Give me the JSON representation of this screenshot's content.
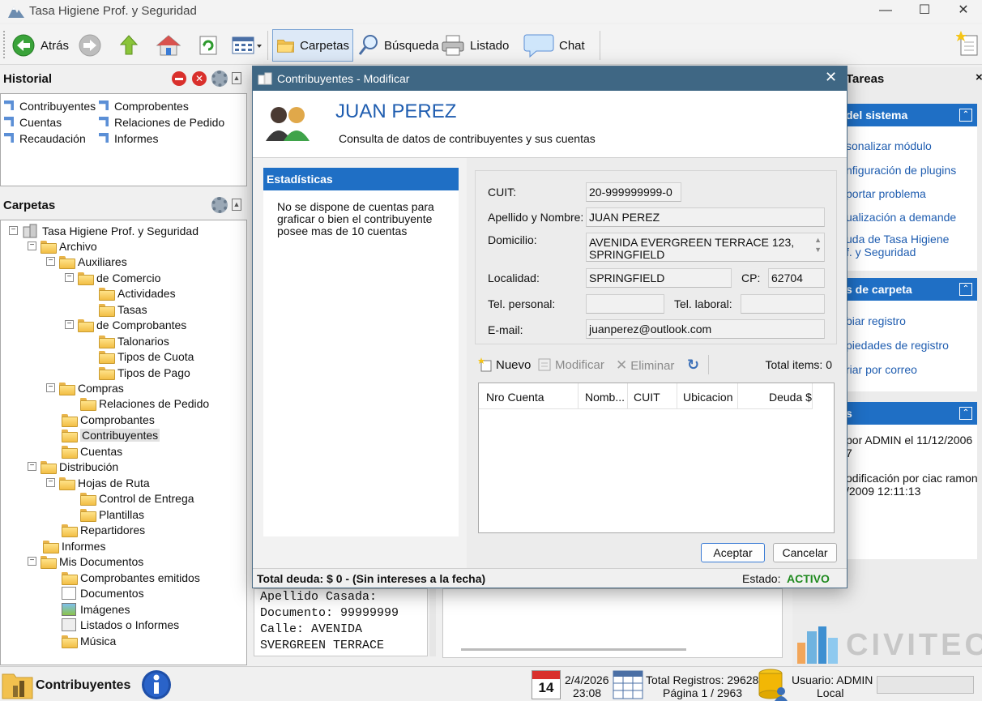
{
  "window": {
    "title": "Tasa Higiene Prof. y Seguridad"
  },
  "toolbar": {
    "back": "Atrás",
    "folders": "Carpetas",
    "search": "Búsqueda",
    "list": "Listado",
    "chat": "Chat"
  },
  "historial": {
    "title": "Historial",
    "col1": [
      "Contribuyentes",
      "Cuentas",
      "Recaudación"
    ],
    "col2": [
      "Comprobentes",
      "Relaciones de Pedido",
      "Informes"
    ]
  },
  "carpetas": {
    "title": "Carpetas",
    "tree": [
      "Tasa Higiene Prof. y Seguridad",
      "Archivo",
      "Auxiliares",
      "de Comercio",
      "Actividades",
      "Tasas",
      "de Comprobantes",
      "Talonarios",
      "Tipos de Cuota",
      "Tipos de Pago",
      "Compras",
      "Relaciones de Pedido",
      "Comprobantes",
      "Contribuyentes",
      "Cuentas",
      "Distribución",
      "Hojas de Ruta",
      "Control de Entrega",
      "Plantillas",
      "Repartidores",
      "Informes",
      "Mis Documentos",
      "Comprobantes emitidos",
      "Documentos",
      "Imágenes",
      "Listados o Informes",
      "Música"
    ]
  },
  "tasks": {
    "title": "Tareas",
    "system_header": "del sistema",
    "system_links": [
      "sonalizar módulo",
      "nfiguración de plugins",
      "portar problema",
      "ualización a demande",
      "uda de Tasa Higiene",
      "f. y Seguridad"
    ],
    "folder_header": "s de carpeta",
    "folder_links": [
      "biar registro",
      "piedades de registro",
      "riar por correo"
    ],
    "details_header": "s",
    "details_lines": [
      "por ADMIN el 11/12/2006",
      "7",
      "odificación por ciac ramon",
      "/2009 12:11:13"
    ]
  },
  "background_text": {
    "lines": [
      "Apellido Casada:",
      "Documento: 99999999",
      "Calle: AVENIDA",
      "SVERGREEN TERRACE"
    ]
  },
  "dialog": {
    "title": "Contribuyentes - Modificar",
    "name": "JUAN PEREZ",
    "subtitle": "Consulta de datos de contribuyentes y sus cuentas",
    "stats_title": "Estadísticas",
    "stats_text": "No se dispone de cuentas para graficar o bien el contribuyente posee mas de 10 cuentas",
    "labels": {
      "cuit": "CUIT:",
      "name": "Apellido y Nombre:",
      "address": "Domicilio:",
      "city": "Localidad:",
      "cp": "CP:",
      "tel_personal": "Tel. personal:",
      "tel_laboral": "Tel. laboral:",
      "email": "E-mail:"
    },
    "values": {
      "cuit": "20-999999999-0",
      "name": "JUAN PEREZ",
      "address_1": "AVENIDA EVERGREEN TERRACE 123,",
      "address_2": "SPRINGFIELD",
      "city": "SPRINGFIELD",
      "cp": "62704",
      "tel_personal": "",
      "tel_laboral": "",
      "email": "juanperez@outlook.com"
    },
    "grid_toolbar": {
      "new": "Nuevo",
      "edit": "Modificar",
      "delete": "Eliminar",
      "total": "Total items: 0"
    },
    "grid_columns": [
      "Nro Cuenta",
      "Nomb...",
      "CUIT",
      "Ubicacion",
      "Deuda $"
    ],
    "accept": "Aceptar",
    "cancel": "Cancelar",
    "total_debt": "Total deuda: $ 0 - (Sin intereses a la fecha)",
    "status_label": "Estado:",
    "status_value": "ACTIVO"
  },
  "statusbar": {
    "module": "Contribuyentes",
    "calendar_day": "14",
    "date": "2/4/2026",
    "time": "23:08",
    "total_records": "Total Registros: 29628",
    "page": "Página 1 / 2963",
    "user": "Usuario: ADMIN",
    "location": "Local"
  },
  "brand": {
    "logo_text": "CIVITEC"
  },
  "colors": {
    "accent": "#1f6fc5",
    "dialog_title": "#3f6784",
    "status_active": "#1f8a1f"
  }
}
